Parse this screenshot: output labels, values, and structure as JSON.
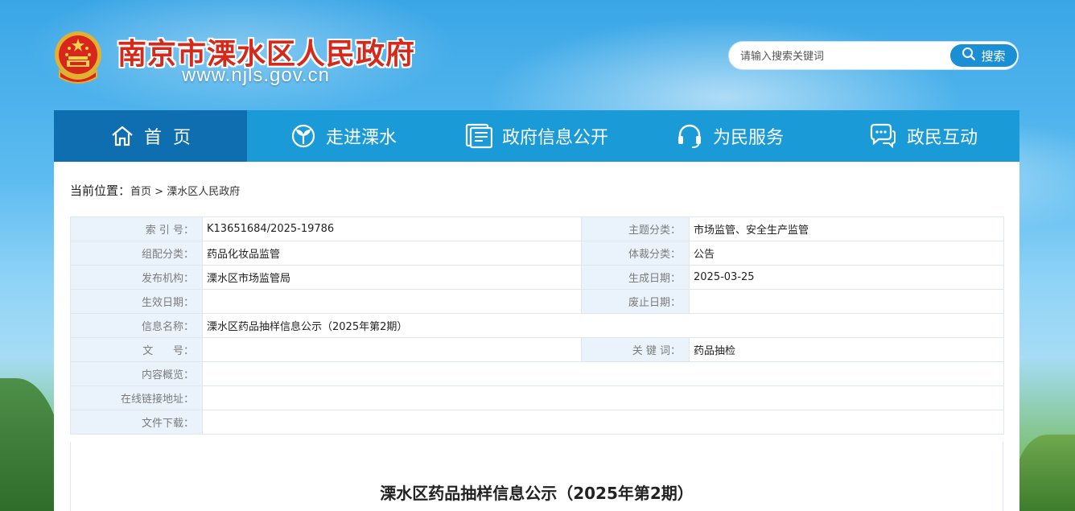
{
  "header": {
    "site_title": "南京市溧水区人民政府",
    "site_url": "www.njls.gov.cn",
    "emblem_icon": "national-emblem-icon"
  },
  "search": {
    "placeholder": "请输入搜索关键词",
    "button_label": "搜索",
    "icon": "search-icon"
  },
  "nav": {
    "items": [
      {
        "label": "首  页",
        "icon": "home-icon",
        "active": true
      },
      {
        "label": "走进溧水",
        "icon": "sprout-icon",
        "active": false
      },
      {
        "label": "政府信息公开",
        "icon": "document-icon",
        "active": false
      },
      {
        "label": "为民服务",
        "icon": "headset-icon",
        "active": false
      },
      {
        "label": "政民互动",
        "icon": "chat-icon",
        "active": false
      }
    ]
  },
  "breadcrumb": {
    "prefix": "当前位置：",
    "home": "首页",
    "separator": ">",
    "current": "溧水区人民政府"
  },
  "info": {
    "index_label": "索 引 号：",
    "index_value": "K13651684/2025-19786",
    "topic_label": "主题分类：",
    "topic_value": "市场监管、安全生产监管",
    "group_label": "组配分类：",
    "group_value": "药品化妆品监管",
    "genre_label": "体裁分类：",
    "genre_value": "公告",
    "org_label": "发布机构：",
    "org_value": "溧水区市场监管局",
    "created_label": "生成日期：",
    "created_value": "2025-03-25",
    "effective_label": "生效日期：",
    "effective_value": "",
    "expire_label": "废止日期：",
    "expire_value": "",
    "name_label": "信息名称：",
    "name_value": "溧水区药品抽样信息公示（2025年第2期）",
    "docno_label": "文      号：",
    "docno_value": "",
    "keyword_label": "关 键 词：",
    "keyword_value": "药品抽检",
    "summary_label": "内容概览：",
    "summary_value": "",
    "link_label": "在线链接地址：",
    "link_value": "",
    "download_label": "文件下载：",
    "download_value": ""
  },
  "document": {
    "title": "溧水区药品抽样信息公示（2025年第2期）"
  },
  "colors": {
    "nav_bg": "#1a9ad6",
    "nav_active": "#0f6eb0",
    "title_red": "#d42a1c",
    "label_bg": "#eaf3fb"
  }
}
